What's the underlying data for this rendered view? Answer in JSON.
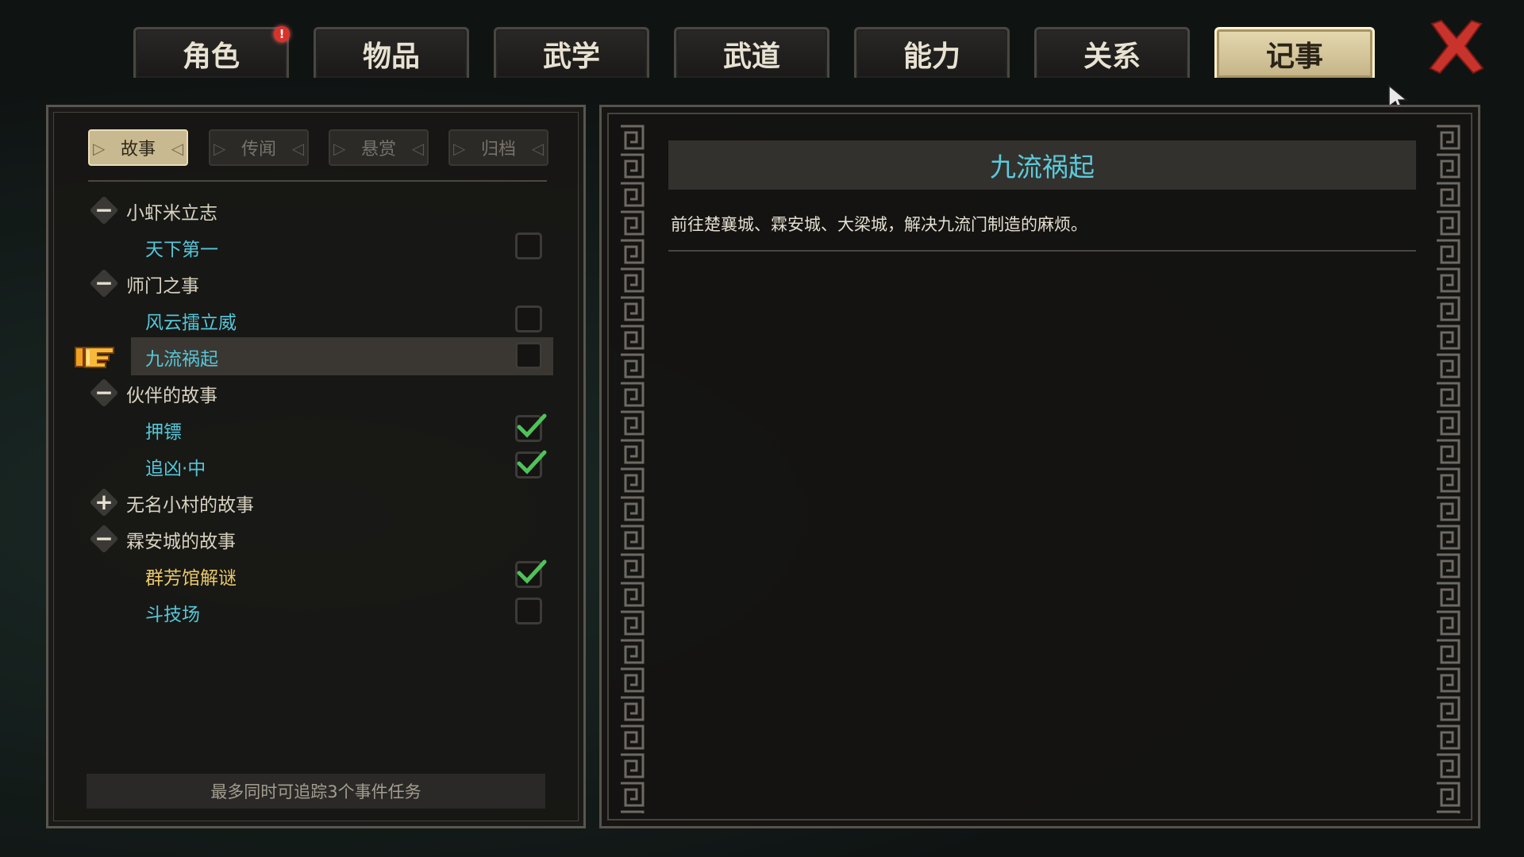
{
  "top_tabs": [
    {
      "label": "角色",
      "alert": "!"
    },
    {
      "label": "物品"
    },
    {
      "label": "武学"
    },
    {
      "label": "武道"
    },
    {
      "label": "能力"
    },
    {
      "label": "关系"
    },
    {
      "label": "记事",
      "active": true
    }
  ],
  "sub_tabs": [
    {
      "label": "故事",
      "active": true
    },
    {
      "label": "传闻"
    },
    {
      "label": "悬赏"
    },
    {
      "label": "归档"
    }
  ],
  "tree": [
    {
      "type": "group",
      "label": "小虾米立志",
      "expanded": true,
      "toggle": "−"
    },
    {
      "type": "quest",
      "label": "天下第一",
      "checked": false
    },
    {
      "type": "group",
      "label": "师门之事",
      "expanded": true,
      "toggle": "−"
    },
    {
      "type": "quest",
      "label": "风云擂立威",
      "checked": false
    },
    {
      "type": "quest",
      "label": "九流祸起",
      "checked": false,
      "selected": true
    },
    {
      "type": "group",
      "label": "伙伴的故事",
      "expanded": true,
      "toggle": "−"
    },
    {
      "type": "quest",
      "label": "押镖",
      "checked": true
    },
    {
      "type": "quest",
      "label": "追凶·中",
      "checked": true
    },
    {
      "type": "group",
      "label": "无名小村的故事",
      "expanded": false,
      "toggle": "+"
    },
    {
      "type": "group",
      "label": "霖安城的故事",
      "expanded": true,
      "toggle": "−"
    },
    {
      "type": "quest",
      "label": "群芳馆解谜",
      "checked": true,
      "gold": true
    },
    {
      "type": "quest",
      "label": "斗技场",
      "checked": false
    }
  ],
  "footer_note": "最多同时可追踪3个事件任务",
  "detail": {
    "title": "九流祸起",
    "description": "前往楚襄城、霖安城、大梁城，解决九流门制造的麻烦。"
  },
  "colors": {
    "quest_text": "#56c6d8",
    "quest_text_gold": "#e8c86a",
    "check_green": "#4fc25a",
    "active_tab": "#d6c89c",
    "close_red": "#d43a32"
  }
}
